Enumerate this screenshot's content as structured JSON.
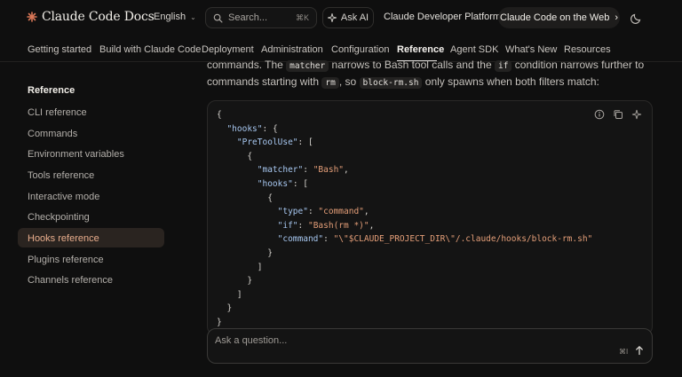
{
  "header": {
    "brand": "Claude Code Docs",
    "language": "English",
    "search_placeholder": "Search...",
    "search_shortcut": "⌘K",
    "ask_ai": "Ask AI",
    "platform_link": "Claude Developer Platform",
    "cta": "Claude Code on the Web",
    "cta_arrow": "›",
    "theme_icon": "moon-icon"
  },
  "tabs": [
    {
      "label": "Getting started"
    },
    {
      "label": "Build with Claude Code"
    },
    {
      "label": "Deployment"
    },
    {
      "label": "Administration"
    },
    {
      "label": "Configuration"
    },
    {
      "label": "Reference",
      "active": true
    },
    {
      "label": "Agent SDK"
    },
    {
      "label": "What's New"
    },
    {
      "label": "Resources"
    }
  ],
  "sidebar": {
    "heading": "Reference",
    "items": [
      {
        "label": "CLI reference"
      },
      {
        "label": "Commands"
      },
      {
        "label": "Environment variables"
      },
      {
        "label": "Tools reference"
      },
      {
        "label": "Interactive mode"
      },
      {
        "label": "Checkpointing"
      },
      {
        "label": "Hooks reference",
        "active": true
      },
      {
        "label": "Plugins reference"
      },
      {
        "label": "Channels reference"
      }
    ]
  },
  "prose": {
    "line1_a": "commands. The ",
    "line1_code1": "matcher",
    "line1_b": " narrows to Bash tool calls and the ",
    "line1_code2": "if",
    "line1_c": " condition narrows further to",
    "line2_a": "commands starting with ",
    "line2_code1": "rm",
    "line2_b": ", so ",
    "line2_code2": "block-rm.sh",
    "line2_c": " only spawns when both filters match:"
  },
  "code": {
    "lines": [
      {
        "indent": "",
        "parts": [
          [
            "p",
            "{"
          ]
        ]
      },
      {
        "indent": "  ",
        "parts": [
          [
            "k",
            "\"hooks\""
          ],
          [
            "p",
            ": {"
          ]
        ]
      },
      {
        "indent": "    ",
        "parts": [
          [
            "k",
            "\"PreToolUse\""
          ],
          [
            "p",
            ": ["
          ]
        ]
      },
      {
        "indent": "      ",
        "parts": [
          [
            "p",
            "{"
          ]
        ]
      },
      {
        "indent": "        ",
        "parts": [
          [
            "k",
            "\"matcher\""
          ],
          [
            "p",
            ": "
          ],
          [
            "s",
            "\"Bash\""
          ],
          [
            "p",
            ","
          ]
        ]
      },
      {
        "indent": "        ",
        "parts": [
          [
            "k",
            "\"hooks\""
          ],
          [
            "p",
            ": ["
          ]
        ]
      },
      {
        "indent": "          ",
        "parts": [
          [
            "p",
            "{"
          ]
        ]
      },
      {
        "indent": "            ",
        "parts": [
          [
            "k",
            "\"type\""
          ],
          [
            "p",
            ": "
          ],
          [
            "s",
            "\"command\""
          ],
          [
            "p",
            ","
          ]
        ]
      },
      {
        "indent": "            ",
        "parts": [
          [
            "k",
            "\"if\""
          ],
          [
            "p",
            ": "
          ],
          [
            "s",
            "\"Bash(rm *)\""
          ],
          [
            "p",
            ","
          ]
        ]
      },
      {
        "indent": "            ",
        "parts": [
          [
            "k",
            "\"command\""
          ],
          [
            "p",
            ": "
          ],
          [
            "s",
            "\"\\\"$CLAUDE_PROJECT_DIR\\\"/.claude/hooks/block-rm.sh\""
          ]
        ]
      },
      {
        "indent": "          ",
        "parts": [
          [
            "p",
            "}"
          ]
        ]
      },
      {
        "indent": "        ",
        "parts": [
          [
            "p",
            "]"
          ]
        ]
      },
      {
        "indent": "      ",
        "parts": [
          [
            "p",
            "}"
          ]
        ]
      },
      {
        "indent": "    ",
        "parts": [
          [
            "p",
            "]"
          ]
        ]
      },
      {
        "indent": "  ",
        "parts": [
          [
            "p",
            "}"
          ]
        ]
      },
      {
        "indent": "",
        "parts": [
          [
            "p",
            "}"
          ]
        ]
      }
    ],
    "tools": [
      "info-icon",
      "copy-icon",
      "sparkle-icon"
    ]
  },
  "ask": {
    "placeholder": "Ask a question...",
    "shortcut": "⌘I",
    "send_icon": "arrow-up-icon"
  },
  "colors": {
    "accent": "#e8ad8c",
    "logo": "#d97757",
    "code_key": "#a7c7f0",
    "code_string": "#e49e78"
  }
}
